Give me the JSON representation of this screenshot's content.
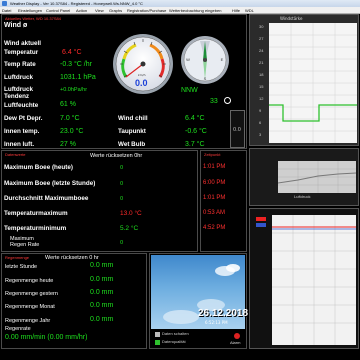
{
  "window": {
    "title": "Weather Display - Ver 10.37S84 - Registered - Honeywell.Ws.NNW_4.0 °C",
    "menu": [
      "Datei",
      "Einstellungen",
      "Control Panel",
      "Action",
      "View",
      "Graphs",
      "Registration/Purchase",
      "Wetterbeobachtung eingeben",
      "Hilfe",
      "WDL"
    ]
  },
  "current": {
    "panel_title": "Aktuelles Wetter, WD 10.37S84",
    "wind_label": "Wind ø",
    "wind_current_label": "Wind aktuell",
    "rows": [
      {
        "label": "Temperatur",
        "value": "6.4 °C",
        "color": "#ff2a2a"
      },
      {
        "label": "Temp Rate",
        "value": "-0.3 °C /hr",
        "color": "#1ee01e"
      },
      {
        "label": "Luftdruck",
        "value": "1031.1 hPa",
        "color": "#1ee01e"
      },
      {
        "label": "Luftdruck Tendenz",
        "value": "+0.0hPa/hr",
        "color": "#1ee01e"
      },
      {
        "label": "Luftfeuchte",
        "value": "61 %",
        "color": "#1ee01e"
      }
    ],
    "lower_rows": [
      {
        "label": "Dew Pt Depr.",
        "value": "7.0 °C",
        "label2": "Wind chill",
        "value2": "6.4 °C"
      },
      {
        "label": "Innen temp.",
        "value": "23.0 °C",
        "label2": "Taupunkt",
        "value2": "-0.6 °C"
      },
      {
        "label": "Innen luft.",
        "value": "27 %",
        "label2": "Wet Bulb",
        "value2": "3.7 °C"
      }
    ],
    "small_readout": "0.0",
    "gauge": {
      "value": "0.0",
      "unit": "km/h",
      "needle_pct": 0.0
    },
    "compass": {
      "direction": "NNW",
      "degrees": "33"
    }
  },
  "extremes": {
    "panel_title": "Datenwerte",
    "reset_label": "Werte rücksetzen 0hr",
    "time_title": "Zeitpunkt",
    "rows": [
      {
        "label": "Maximum Boee (heute)",
        "value": "0",
        "time": "1:01 PM"
      },
      {
        "label": "Maximum Boee (letzte Stunde)",
        "value": "0",
        "time": "6:00 PM"
      },
      {
        "label": "Durchschnitt Maximumboee",
        "value": "0",
        "time": "1:01 PM"
      },
      {
        "label": "Temperaturmaximum",
        "value": "13.0 °C",
        "time": "0:53 AM"
      },
      {
        "label": "Temperaturminimum",
        "value": "5.2 °C",
        "time": "4:52 PM"
      },
      {
        "label": "Maximum Regen Rate",
        "value": "0",
        "time": ""
      }
    ]
  },
  "rain": {
    "panel_title": "Regenmenge",
    "reset_label": "Werte rücksetzen 0 hr",
    "rows": [
      {
        "label": "letzte Stunde",
        "value": "0.0 mm"
      },
      {
        "label": "Regenmenge heute",
        "value": "0.0 mm"
      },
      {
        "label": "Regenmenge gestern",
        "value": "0.0 mm"
      },
      {
        "label": "Regenmenge Monat",
        "value": "0.0 mm"
      },
      {
        "label": "Regenmenge Jahr",
        "value": "0.0 mm"
      }
    ],
    "rate_label": "Regenrate",
    "rate_value": "0.00 mm/min (0.00 mm/hr)"
  },
  "webcam": {
    "date": "26.12.2018",
    "time": "6:52:13 PM",
    "alarm_label": "Alarm",
    "legend": [
      "Daten schalten",
      "Datenqualität"
    ]
  },
  "graphs": {
    "top_title": "Windstärke",
    "mid_label": "Luftdruck",
    "y_ticks": [
      "30",
      "27",
      "24",
      "21",
      "18",
      "15",
      "12",
      "9",
      "6",
      "3"
    ]
  },
  "colors": {
    "accent_green": "#1ee01e",
    "accent_red": "#ff2a2a",
    "panel_border": "#4a4a4a"
  }
}
